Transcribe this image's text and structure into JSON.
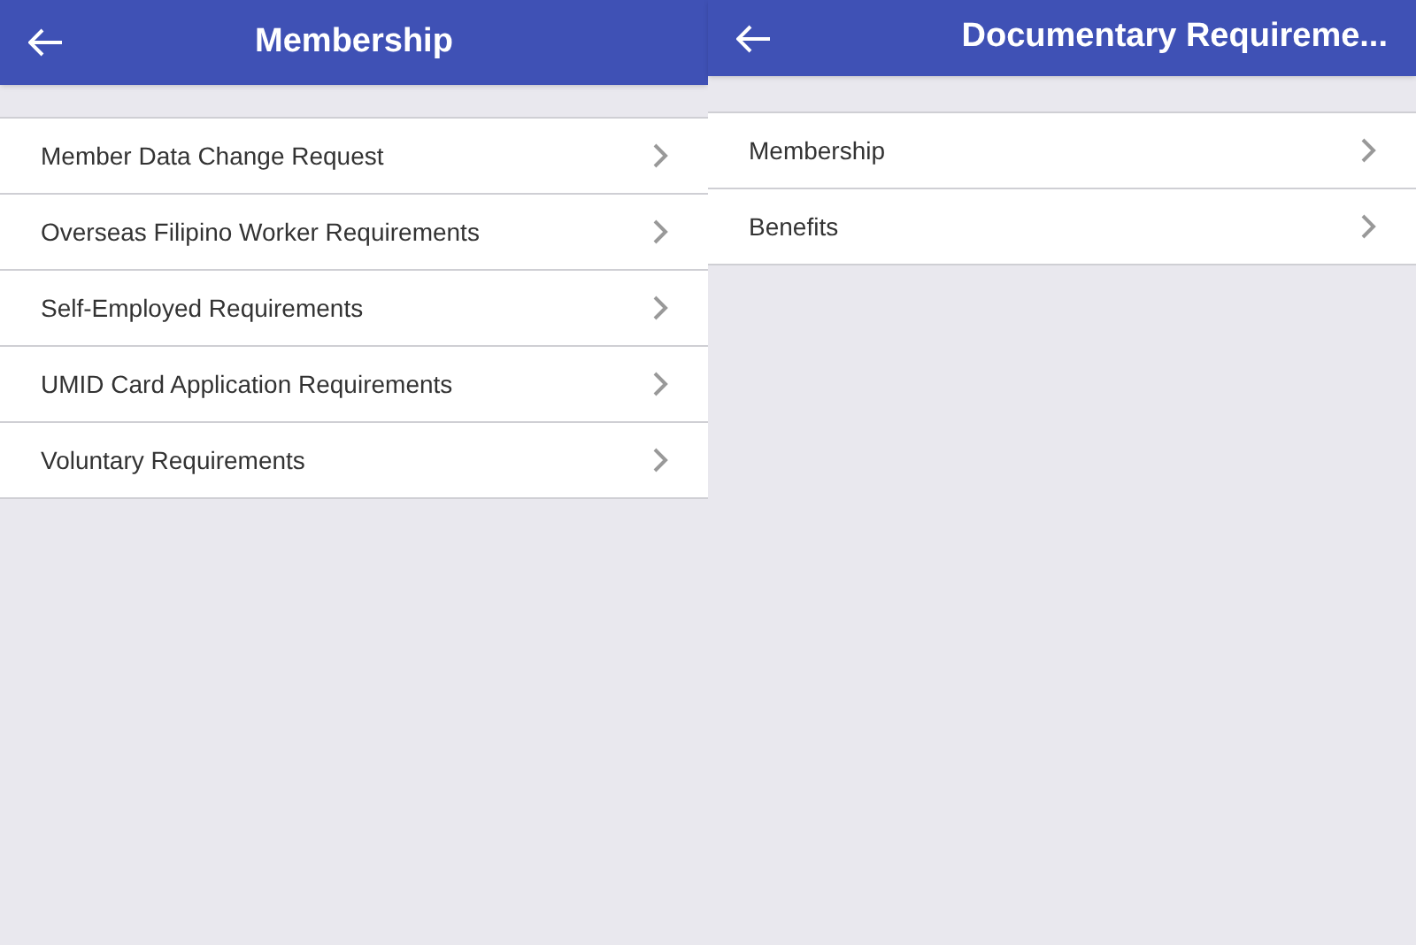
{
  "screens": [
    {
      "title": "Membership",
      "items": [
        {
          "label": "Member Data Change Request"
        },
        {
          "label": "Overseas Filipino Worker Requirements"
        },
        {
          "label": "Self-Employed Requirements"
        },
        {
          "label": "UMID Card Application Requirements"
        },
        {
          "label": "Voluntary Requirements"
        }
      ]
    },
    {
      "title": "Documentary Requireme...",
      "items": [
        {
          "label": "Membership"
        },
        {
          "label": "Benefits"
        }
      ]
    }
  ]
}
